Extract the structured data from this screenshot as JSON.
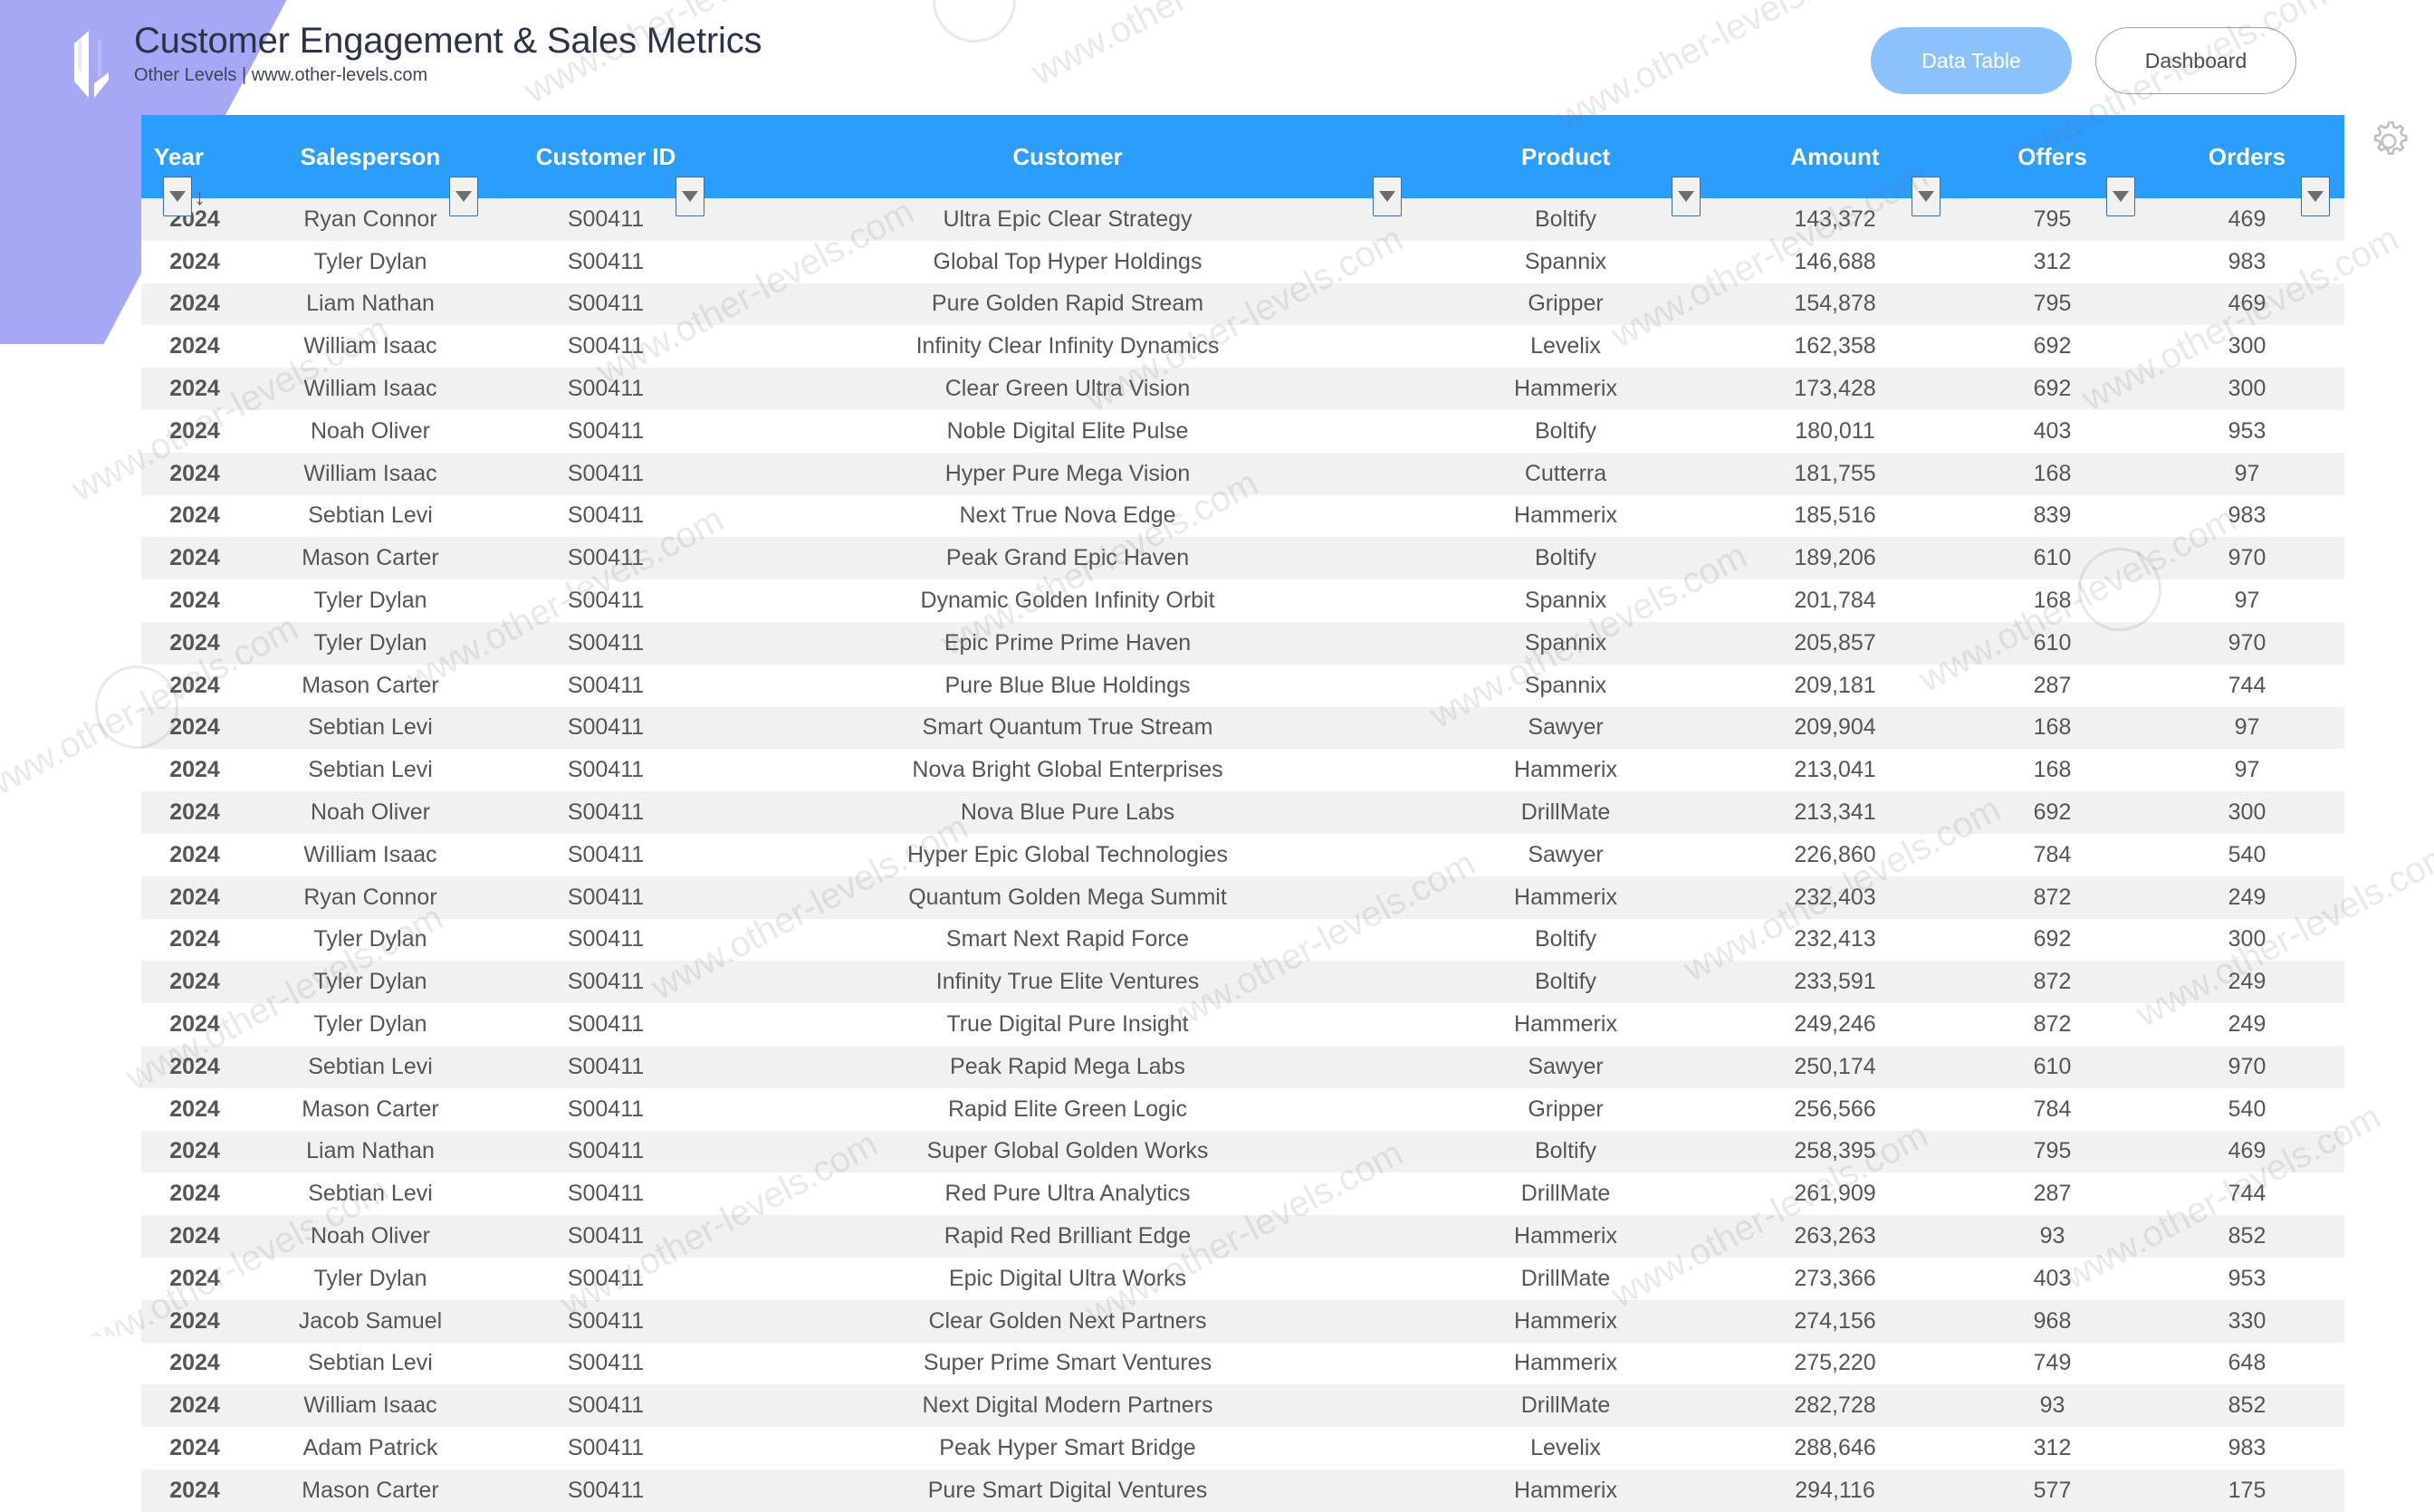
{
  "branding": {
    "logo_name": "OL",
    "title": "Customer Engagement & Sales Metrics",
    "subtitle": "Other Levels | www.other-levels.com",
    "accent_blue": "#2d9cff",
    "accent_year": "#5b53f0",
    "band_blue": "#8fc4f2",
    "band_purple": "#a6a8f5"
  },
  "view_toggle": {
    "active_label": "Data Table",
    "inactive_label": "Dashboard"
  },
  "settings": {
    "icon": "gear-icon"
  },
  "watermark": {
    "text": "www.other-levels.com"
  },
  "table": {
    "columns": [
      {
        "label": "Year",
        "key": "year",
        "filter": true,
        "sorted": true,
        "sort_direction": "ascending"
      },
      {
        "label": "Salesperson",
        "key": "salesperson",
        "filter": true
      },
      {
        "label": "Customer ID",
        "key": "customer_id",
        "filter": true
      },
      {
        "label": "Customer",
        "key": "customer",
        "filter": true
      },
      {
        "label": "Product",
        "key": "product",
        "filter": true
      },
      {
        "label": "Amount",
        "key": "amount",
        "filter": true
      },
      {
        "label": "Offers",
        "key": "offers",
        "filter": true
      },
      {
        "label": "Orders",
        "key": "orders",
        "filter": true
      }
    ],
    "rows": [
      {
        "year": "2024",
        "salesperson": "Ryan Connor",
        "customer_id": "S00411",
        "customer": "Ultra Epic Clear Strategy",
        "product": "Boltify",
        "amount": "143,372",
        "offers": "795",
        "orders": "469"
      },
      {
        "year": "2024",
        "salesperson": "Tyler Dylan",
        "customer_id": "S00411",
        "customer": "Global Top Hyper Holdings",
        "product": "Spannix",
        "amount": "146,688",
        "offers": "312",
        "orders": "983"
      },
      {
        "year": "2024",
        "salesperson": "Liam Nathan",
        "customer_id": "S00411",
        "customer": "Pure Golden Rapid Stream",
        "product": "Gripper",
        "amount": "154,878",
        "offers": "795",
        "orders": "469"
      },
      {
        "year": "2024",
        "salesperson": "William Isaac",
        "customer_id": "S00411",
        "customer": "Infinity Clear Infinity Dynamics",
        "product": "Levelix",
        "amount": "162,358",
        "offers": "692",
        "orders": "300"
      },
      {
        "year": "2024",
        "salesperson": "William Isaac",
        "customer_id": "S00411",
        "customer": "Clear Green Ultra Vision",
        "product": "Hammerix",
        "amount": "173,428",
        "offers": "692",
        "orders": "300"
      },
      {
        "year": "2024",
        "salesperson": "Noah Oliver",
        "customer_id": "S00411",
        "customer": "Noble Digital Elite Pulse",
        "product": "Boltify",
        "amount": "180,011",
        "offers": "403",
        "orders": "953"
      },
      {
        "year": "2024",
        "salesperson": "William Isaac",
        "customer_id": "S00411",
        "customer": "Hyper Pure Mega Vision",
        "product": "Cutterra",
        "amount": "181,755",
        "offers": "168",
        "orders": "97"
      },
      {
        "year": "2024",
        "salesperson": "Sebtian Levi",
        "customer_id": "S00411",
        "customer": "Next True Nova Edge",
        "product": "Hammerix",
        "amount": "185,516",
        "offers": "839",
        "orders": "983"
      },
      {
        "year": "2024",
        "salesperson": "Mason Carter",
        "customer_id": "S00411",
        "customer": "Peak Grand Epic Haven",
        "product": "Boltify",
        "amount": "189,206",
        "offers": "610",
        "orders": "970"
      },
      {
        "year": "2024",
        "salesperson": "Tyler Dylan",
        "customer_id": "S00411",
        "customer": "Dynamic Golden Infinity Orbit",
        "product": "Spannix",
        "amount": "201,784",
        "offers": "168",
        "orders": "97"
      },
      {
        "year": "2024",
        "salesperson": "Tyler Dylan",
        "customer_id": "S00411",
        "customer": "Epic Prime Prime Haven",
        "product": "Spannix",
        "amount": "205,857",
        "offers": "610",
        "orders": "970"
      },
      {
        "year": "2024",
        "salesperson": "Mason Carter",
        "customer_id": "S00411",
        "customer": "Pure Blue Blue Holdings",
        "product": "Spannix",
        "amount": "209,181",
        "offers": "287",
        "orders": "744"
      },
      {
        "year": "2024",
        "salesperson": "Sebtian Levi",
        "customer_id": "S00411",
        "customer": "Smart Quantum True Stream",
        "product": "Sawyer",
        "amount": "209,904",
        "offers": "168",
        "orders": "97"
      },
      {
        "year": "2024",
        "salesperson": "Sebtian Levi",
        "customer_id": "S00411",
        "customer": "Nova Bright Global Enterprises",
        "product": "Hammerix",
        "amount": "213,041",
        "offers": "168",
        "orders": "97"
      },
      {
        "year": "2024",
        "salesperson": "Noah Oliver",
        "customer_id": "S00411",
        "customer": "Nova Blue Pure Labs",
        "product": "DrillMate",
        "amount": "213,341",
        "offers": "692",
        "orders": "300"
      },
      {
        "year": "2024",
        "salesperson": "William Isaac",
        "customer_id": "S00411",
        "customer": "Hyper Epic Global Technologies",
        "product": "Sawyer",
        "amount": "226,860",
        "offers": "784",
        "orders": "540"
      },
      {
        "year": "2024",
        "salesperson": "Ryan Connor",
        "customer_id": "S00411",
        "customer": "Quantum Golden Mega Summit",
        "product": "Hammerix",
        "amount": "232,403",
        "offers": "872",
        "orders": "249"
      },
      {
        "year": "2024",
        "salesperson": "Tyler Dylan",
        "customer_id": "S00411",
        "customer": "Smart Next Rapid Force",
        "product": "Boltify",
        "amount": "232,413",
        "offers": "692",
        "orders": "300"
      },
      {
        "year": "2024",
        "salesperson": "Tyler Dylan",
        "customer_id": "S00411",
        "customer": "Infinity True Elite Ventures",
        "product": "Boltify",
        "amount": "233,591",
        "offers": "872",
        "orders": "249"
      },
      {
        "year": "2024",
        "salesperson": "Tyler Dylan",
        "customer_id": "S00411",
        "customer": "True Digital Pure Insight",
        "product": "Hammerix",
        "amount": "249,246",
        "offers": "872",
        "orders": "249"
      },
      {
        "year": "2024",
        "salesperson": "Sebtian Levi",
        "customer_id": "S00411",
        "customer": "Peak Rapid Mega Labs",
        "product": "Sawyer",
        "amount": "250,174",
        "offers": "610",
        "orders": "970"
      },
      {
        "year": "2024",
        "salesperson": "Mason Carter",
        "customer_id": "S00411",
        "customer": "Rapid Elite Green Logic",
        "product": "Gripper",
        "amount": "256,566",
        "offers": "784",
        "orders": "540"
      },
      {
        "year": "2024",
        "salesperson": "Liam Nathan",
        "customer_id": "S00411",
        "customer": "Super Global Golden Works",
        "product": "Boltify",
        "amount": "258,395",
        "offers": "795",
        "orders": "469"
      },
      {
        "year": "2024",
        "salesperson": "Sebtian Levi",
        "customer_id": "S00411",
        "customer": "Red Pure Ultra Analytics",
        "product": "DrillMate",
        "amount": "261,909",
        "offers": "287",
        "orders": "744"
      },
      {
        "year": "2024",
        "salesperson": "Noah Oliver",
        "customer_id": "S00411",
        "customer": "Rapid Red Brilliant Edge",
        "product": "Hammerix",
        "amount": "263,263",
        "offers": "93",
        "orders": "852"
      },
      {
        "year": "2024",
        "salesperson": "Tyler Dylan",
        "customer_id": "S00411",
        "customer": "Epic Digital Ultra Works",
        "product": "DrillMate",
        "amount": "273,366",
        "offers": "403",
        "orders": "953"
      },
      {
        "year": "2024",
        "salesperson": "Jacob Samuel",
        "customer_id": "S00411",
        "customer": "Clear Golden Next Partners",
        "product": "Hammerix",
        "amount": "274,156",
        "offers": "968",
        "orders": "330"
      },
      {
        "year": "2024",
        "salesperson": "Sebtian Levi",
        "customer_id": "S00411",
        "customer": "Super Prime Smart Ventures",
        "product": "Hammerix",
        "amount": "275,220",
        "offers": "749",
        "orders": "648"
      },
      {
        "year": "2024",
        "salesperson": "William Isaac",
        "customer_id": "S00411",
        "customer": "Next Digital Modern Partners",
        "product": "DrillMate",
        "amount": "282,728",
        "offers": "93",
        "orders": "852"
      },
      {
        "year": "2024",
        "salesperson": "Adam Patrick",
        "customer_id": "S00411",
        "customer": "Peak Hyper Smart Bridge",
        "product": "Levelix",
        "amount": "288,646",
        "offers": "312",
        "orders": "983"
      },
      {
        "year": "2024",
        "salesperson": "Mason Carter",
        "customer_id": "S00411",
        "customer": "Pure Smart Digital Ventures",
        "product": "Hammerix",
        "amount": "294,116",
        "offers": "577",
        "orders": "175"
      }
    ]
  }
}
